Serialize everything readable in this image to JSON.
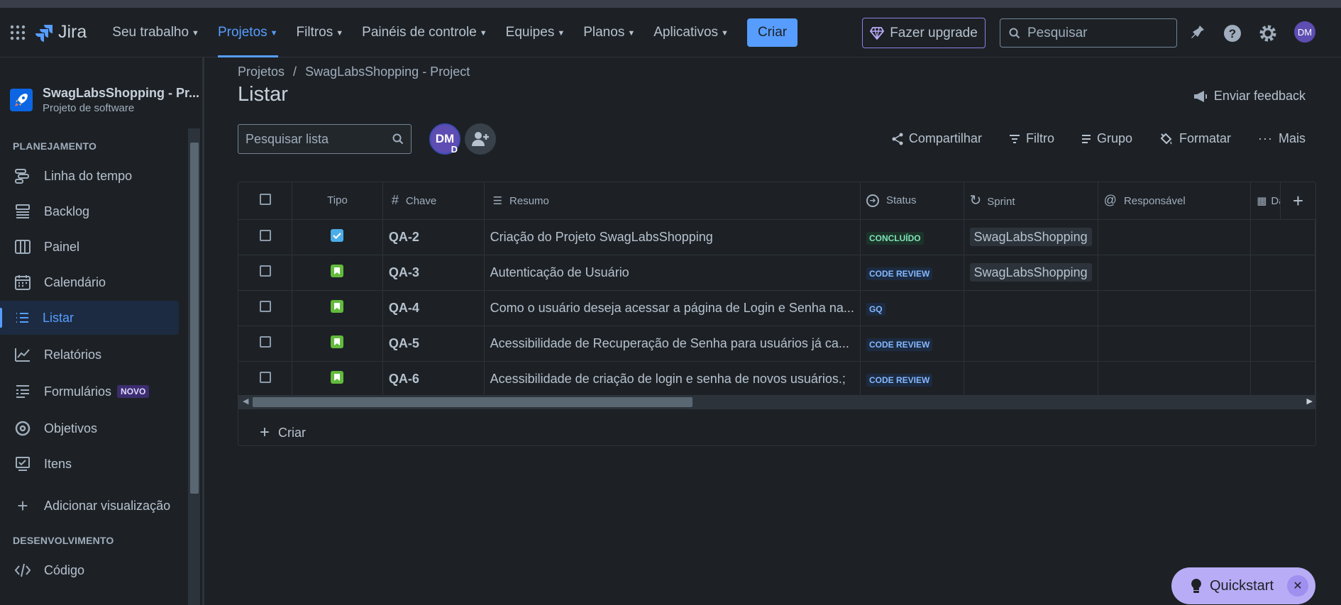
{
  "app": {
    "name": "Jira"
  },
  "topnav": {
    "items": [
      {
        "label": "Seu trabalho"
      },
      {
        "label": "Projetos",
        "active": true
      },
      {
        "label": "Filtros"
      },
      {
        "label": "Painéis de controle"
      },
      {
        "label": "Equipes"
      },
      {
        "label": "Planos"
      },
      {
        "label": "Aplicativos"
      }
    ],
    "create_label": "Criar",
    "upgrade_label": "Fazer upgrade",
    "search_placeholder": "Pesquisar",
    "avatar_initials": "DM"
  },
  "sidebar": {
    "project_name": "SwagLabsShopping - Pr...",
    "project_type": "Projeto de software",
    "section_planning": "PLANEJAMENTO",
    "items": [
      {
        "label": "Linha do tempo",
        "icon": "timeline-icon"
      },
      {
        "label": "Backlog",
        "icon": "backlog-icon"
      },
      {
        "label": "Painel",
        "icon": "board-icon"
      },
      {
        "label": "Calendário",
        "icon": "calendar-icon"
      },
      {
        "label": "Listar",
        "icon": "list-icon",
        "active": true
      },
      {
        "label": "Relatórios",
        "icon": "reports-icon"
      },
      {
        "label": "Formulários",
        "icon": "forms-icon",
        "badge": "NOVO"
      },
      {
        "label": "Objetivos",
        "icon": "goals-icon"
      },
      {
        "label": "Itens",
        "icon": "items-icon"
      }
    ],
    "add_view_label": "Adicionar visualização",
    "section_dev": "DESENVOLVIMENTO",
    "code_label": "Código"
  },
  "main": {
    "breadcrumb": [
      "Projetos",
      "SwagLabsShopping - Project"
    ],
    "breadcrumb_sep": "/",
    "title": "Listar",
    "feedback_label": "Enviar feedback",
    "list_search_placeholder": "Pesquisar lista",
    "avatar_initials": "DM",
    "avatar_sub": "D",
    "tools": [
      "Compartilhar",
      "Filtro",
      "Grupo",
      "Formatar",
      "Mais"
    ],
    "create_label": "Criar"
  },
  "table": {
    "headers": [
      "Tipo",
      "Chave",
      "Resumo",
      "Status",
      "Sprint",
      "Responsável",
      "Da"
    ],
    "rows": [
      {
        "type": "task",
        "key": "QA-2",
        "summary": "Criação do Projeto SwagLabsShopping",
        "status": "CONCLUÍDO",
        "status_kind": "done",
        "sprint": "SwagLabsShopping"
      },
      {
        "type": "story",
        "key": "QA-3",
        "summary": "Autenticação de Usuário",
        "status": "CODE REVIEW",
        "status_kind": "blue",
        "sprint": "SwagLabsShopping"
      },
      {
        "type": "story",
        "key": "QA-4",
        "summary": "Como o usuário deseja acessar a página de Login e Senha na...",
        "status": "GQ",
        "status_kind": "blue",
        "sprint": ""
      },
      {
        "type": "story",
        "key": "QA-5",
        "summary": "Acessibilidade de Recuperação de Senha para usuários já ca...",
        "status": "CODE REVIEW",
        "status_kind": "blue",
        "sprint": ""
      },
      {
        "type": "story",
        "key": "QA-6",
        "summary": "Acessibilidade de criação de login e senha de novos usuários.;",
        "status": "CODE REVIEW",
        "status_kind": "blue",
        "sprint": ""
      }
    ]
  },
  "quickstart": {
    "label": "Quickstart"
  },
  "colors": {
    "accent": "#579dff",
    "background": "#1d2125",
    "quickstart": "#b8acf6"
  }
}
